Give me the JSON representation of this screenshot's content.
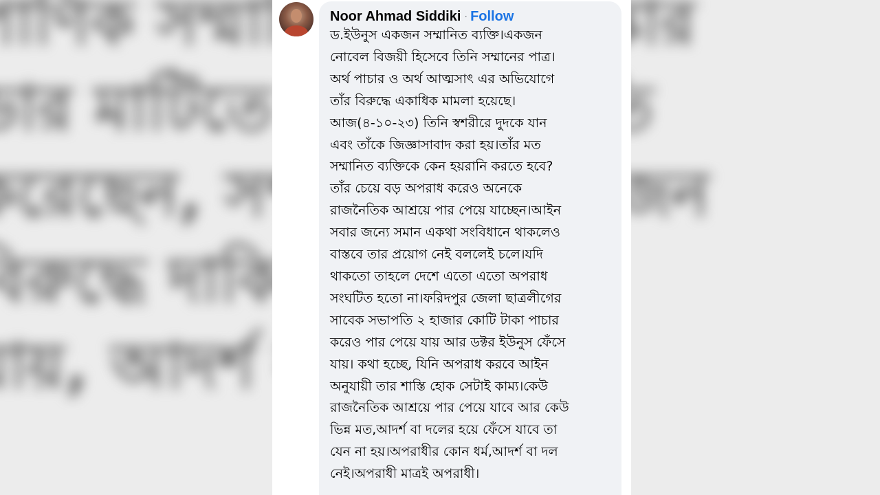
{
  "post": {
    "author": "Noor Ahmad Siddiki",
    "separator": "·",
    "follow_label": "Follow",
    "lines": [
      "ড.ইউনুস একজন সম্মানিত ব্যক্তি।একজন",
      "নোবেল বিজয়ী হিসেবে তিনি সম্মানের পাত্র।",
      "অর্থ পাচার ও অর্থ আত্মসাৎ এর অভিযোগে",
      "তাঁর বিরুদ্ধে  একাধিক মামলা হয়েছে।",
      "আজ(৪-১০-২৩) তিনি স্বশরীরে দুদকে যান",
      "এবং তাঁকে জিজ্ঞাসাবাদ করা হয়।তাঁর মত",
      "সম্মানিত ব্যক্তিকে কেন হয়রানি করতে হবে?",
      "তাঁর চেয়ে বড় অপরাধ করেও অনেকে",
      "রাজনৈতিক আশ্রয়ে পার পেয়ে যাচ্ছেন।আইন",
      "সবার জন্যে সমান একথা সংবিধানে থাকলেও",
      "বাস্তবে তার প্রয়োগ নেই বললেই চলে।যদি",
      "থাকতো তাহলে দেশে এতো এতো অপরাধ",
      "সংঘটিত হতো না।ফরিদপুর জেলা ছাত্রলীগের",
      "সাবেক সভাপতি ২ হাজার কোটি টাকা পাচার",
      "করেও পার পেয়ে যায় আর ডক্টর ইউনুস ফেঁসে",
      "যায়। কথা হচ্ছে, যিনি অপরাধ করবে আইন",
      "অনুযায়ী তার শাস্তি হোক সেটাই কাম্য।কেউ",
      "রাজনৈতিক আশ্রয়ে পার পেয়ে যাবে আর কেউ",
      "ভিন্ন মত,আদর্শ বা দলের হয়ে ফেঁসে যাবে তা",
      "যেন না হয়।অপরাধীর কোন ধর্ম,আদর্শ বা দল",
      "নেই।অপরাধী মাত্রই অপরাধী।"
    ]
  },
  "colors": {
    "bubble": "#f0f2f5",
    "follow": "#1b74e4",
    "text": "#050505"
  },
  "icons": {
    "avatar": "profile-photo"
  }
}
